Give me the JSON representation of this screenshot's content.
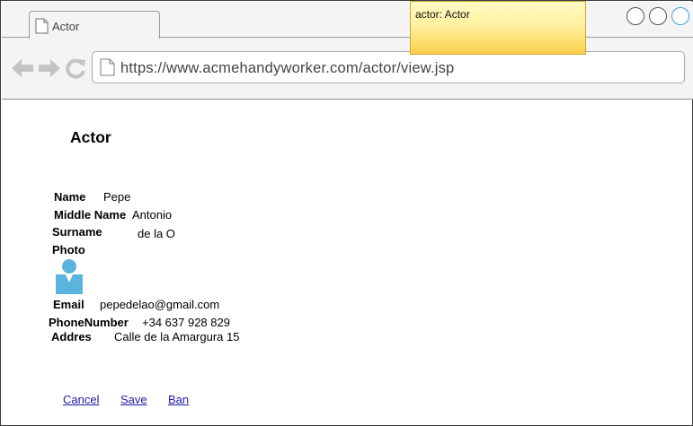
{
  "browser": {
    "tab_title": "Actor",
    "url": "https://www.acmehandyworker.com/actor/view.jsp",
    "icons": {
      "back": "arrow-left-icon",
      "forward": "arrow-right-icon",
      "reload": "reload-icon",
      "page": "document-icon"
    }
  },
  "note": {
    "text": "actor: Actor"
  },
  "page": {
    "title": "Actor"
  },
  "profile": {
    "name_label": "Name",
    "name_value": "Pepe",
    "middle_name_label": "Middle Name",
    "middle_name_value": "Antonio",
    "surname_label": "Surname",
    "surname_value": "de la O",
    "photo_label": "Photo",
    "photo_icon": "user-avatar-icon",
    "email_label": "Email",
    "email_value": "pepedelao@gmail.com",
    "phone_label": "PhoneNumber",
    "phone_value": "+34 637 928 829",
    "address_label": "Addres",
    "address_value": "Calle de la Amargura 15"
  },
  "actions": {
    "cancel": "Cancel",
    "save": "Save",
    "ban": "Ban"
  },
  "colors": {
    "avatar": "#5bb4de",
    "link": "#1a1aa6",
    "note_top": "#fffbc4",
    "note_bottom": "#ffd04a"
  }
}
